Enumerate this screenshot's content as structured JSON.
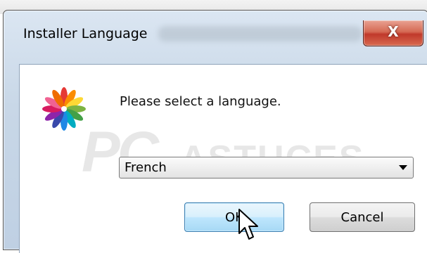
{
  "window": {
    "title": "Installer Language",
    "close_glyph": "X"
  },
  "dialog": {
    "prompt": "Please select a language.",
    "language_select": {
      "selected": "French"
    },
    "ok_label": "OK",
    "cancel_label": "Cancel"
  },
  "watermark": {
    "part1": "PC",
    "part2": "ASTUCES"
  },
  "icons": {
    "logo": "multicolor-flower-icon",
    "dropdown": "chevron-down-icon",
    "cursor": "mouse-pointer-icon"
  },
  "colors": {
    "titlebar": "#c8d7e7",
    "close_button": "#c0392b",
    "ok_button": "#bee6fd"
  }
}
